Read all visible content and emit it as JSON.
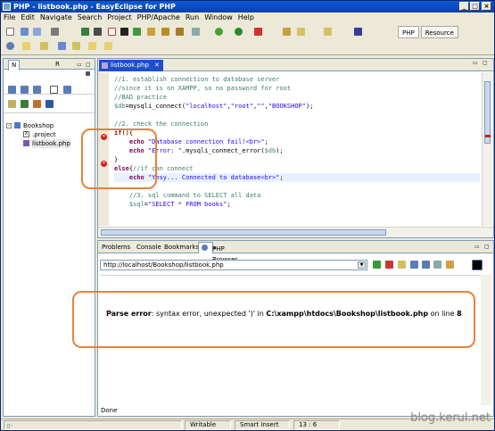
{
  "window": {
    "title": "PHP - listbook.php - EasyEclipse for PHP",
    "controls": [
      "_",
      "□",
      "×"
    ]
  },
  "menu": [
    "File",
    "Edit",
    "Navigate",
    "Search",
    "Project",
    "PHP/Apache",
    "Run",
    "Window",
    "Help"
  ],
  "perspectives": [
    {
      "label": "PHP",
      "active": true
    },
    {
      "label": "Resource",
      "active": false
    }
  ],
  "navigator": {
    "tabs": [
      "N",
      "R"
    ],
    "tree": [
      {
        "label": "Bookshop",
        "level": 0,
        "type": "project"
      },
      {
        "label": ".project",
        "level": 1,
        "type": "file"
      },
      {
        "label": "listbook.php",
        "level": 1,
        "type": "php"
      }
    ]
  },
  "editor": {
    "tab_label": "listbook.php",
    "lines": [
      {
        "tokens": [
          {
            "t": "//1. establish connection to database server",
            "c": "c-c"
          }
        ]
      },
      {
        "tokens": [
          {
            "t": "//since it is on XAMPP, so no password for root",
            "c": "c-c"
          }
        ]
      },
      {
        "tokens": [
          {
            "t": "//BAD practice",
            "c": "c-c"
          }
        ]
      },
      {
        "tokens": [
          {
            "t": "$db",
            "c": "c-v"
          },
          {
            "t": "=mysqli_connect(",
            "c": "c-d"
          },
          {
            "t": "\"localhost\"",
            "c": "c-s"
          },
          {
            "t": ",",
            "c": "c-d"
          },
          {
            "t": "\"root\"",
            "c": "c-s"
          },
          {
            "t": ",",
            "c": "c-d"
          },
          {
            "t": "\"\"",
            "c": "c-s"
          },
          {
            "t": ",",
            "c": "c-d"
          },
          {
            "t": "\"BOOKSHOP\"",
            "c": "c-s"
          },
          {
            "t": ");",
            "c": "c-d"
          }
        ]
      },
      {
        "tokens": [
          {
            "t": "",
            "c": "c-d"
          }
        ]
      },
      {
        "tokens": [
          {
            "t": "//2. check the connection",
            "c": "c-c"
          }
        ]
      },
      {
        "tokens": [
          {
            "t": "if",
            "c": "c-k"
          },
          {
            "t": "(){",
            "c": "c-d"
          }
        ],
        "error": true
      },
      {
        "tokens": [
          {
            "t": "    echo ",
            "c": "c-k"
          },
          {
            "t": "\"Database connection fail!<br>\"",
            "c": "c-s"
          },
          {
            "t": ";",
            "c": "c-d"
          }
        ]
      },
      {
        "tokens": [
          {
            "t": "    echo ",
            "c": "c-k"
          },
          {
            "t": "\"Error: \"",
            "c": "c-s"
          },
          {
            "t": ".mysqli_connect_error(",
            "c": "c-d"
          },
          {
            "t": "$db",
            "c": "c-v"
          },
          {
            "t": ");",
            "c": "c-d"
          }
        ]
      },
      {
        "tokens": [
          {
            "t": "}",
            "c": "c-d"
          }
        ],
        "error": true
      },
      {
        "tokens": [
          {
            "t": "else",
            "c": "c-k"
          },
          {
            "t": "{",
            "c": "c-d"
          },
          {
            "t": "//if can connect",
            "c": "c-c"
          }
        ]
      },
      {
        "tokens": [
          {
            "t": "    echo ",
            "c": "c-k"
          },
          {
            "t": "\"Yesy... Connected to database<br>\"",
            "c": "c-s"
          },
          {
            "t": ";",
            "c": "c-d"
          }
        ],
        "highlight": true
      },
      {
        "tokens": [
          {
            "t": "",
            "c": "c-d"
          }
        ]
      },
      {
        "tokens": [
          {
            "t": "    //3. sql command to SELECT all data",
            "c": "c-c"
          }
        ]
      },
      {
        "tokens": [
          {
            "t": "    $sql",
            "c": "c-v"
          },
          {
            "t": "=",
            "c": "c-d"
          },
          {
            "t": "\"SELECT * FROM books\"",
            "c": "c-s"
          },
          {
            "t": ";",
            "c": "c-d"
          }
        ]
      }
    ]
  },
  "bottom_panel": {
    "tabs": [
      {
        "label": "Problems",
        "active": false
      },
      {
        "label": "Console",
        "active": false
      },
      {
        "label": "Bookmarks",
        "active": false
      },
      {
        "label": "PHP Browser",
        "active": true
      }
    ],
    "url": "http://localhost/Bookshop/listbook.php",
    "error": {
      "prefix": "Parse error",
      "message": ": syntax error, unexpected ')' in ",
      "path": "C:\\xampp\\htdocs\\Bookshop\\listbook.php",
      "on_line": " on line ",
      "line": "8"
    },
    "status_text": "Done"
  },
  "statusbar": {
    "mode": "Writable",
    "insert": "Smart Insert",
    "position": "13 : 6"
  },
  "watermark": "blog.kerul.net",
  "colors": {
    "title_bar": "#0a5ad7",
    "annotation": "#e8823a",
    "error_marker": "#d21c1c"
  }
}
